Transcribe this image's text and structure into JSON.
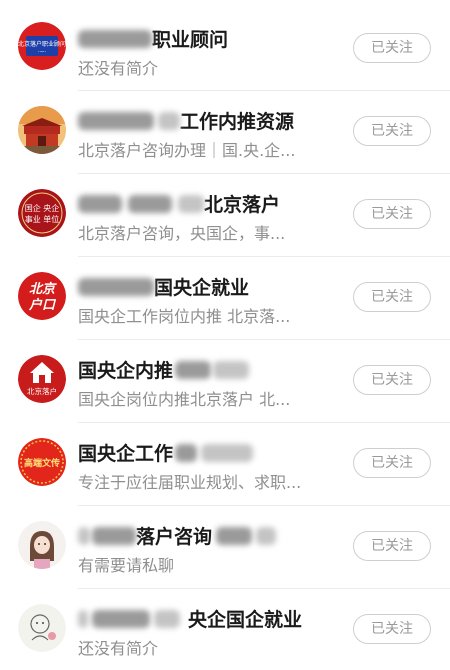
{
  "follow_list": {
    "items": [
      {
        "avatar": "red-circle-logo-icon",
        "avatar_text": "北京落户职业顾问",
        "title_visible": "职业顾问",
        "description": "还没有简介",
        "button_label": "已关注"
      },
      {
        "avatar": "tiananmen-photo-icon",
        "title_visible": "工作内推资源",
        "description": "北京落户咨询办理｜国.央.企...",
        "button_label": "已关注"
      },
      {
        "avatar": "red-seal-logo-icon",
        "avatar_text_line1": "国企 央企",
        "avatar_text_line2": "事业 单位",
        "title_visible": "北京落户",
        "description": "北京落户咨询，央国企，事...",
        "button_label": "已关注"
      },
      {
        "avatar": "beijing-hukou-text-icon",
        "avatar_text_line1": "北京",
        "avatar_text_line2": "户口",
        "title_visible": "国央企就业",
        "description": "国央企工作岗位内推 北京落...",
        "button_label": "已关注"
      },
      {
        "avatar": "house-logo-icon",
        "avatar_text": "北京落户",
        "title_visible": "国央企内推",
        "description": "国央企岗位内推北京落户 北...",
        "button_label": "已关注"
      },
      {
        "avatar": "festive-red-logo-icon",
        "avatar_text": "高端文传",
        "title_visible": "国央企工作",
        "description": "专注于应往届职业规划、求职...",
        "button_label": "已关注"
      },
      {
        "avatar": "cartoon-girl-avatar-icon",
        "title_visible": "落户咨询",
        "description": "有需要请私聊",
        "button_label": "已关注"
      },
      {
        "avatar": "cartoon-sketch-avatar-icon",
        "title_visible": "央企国企就业",
        "description": "还没有简介",
        "button_label": "已关注"
      }
    ]
  },
  "colors": {
    "title": "#1a1a1a",
    "description": "#8f8f8f",
    "button_border": "#cfcfcf",
    "button_text": "#9a9a9a",
    "brand_red": "#d81e1e"
  }
}
